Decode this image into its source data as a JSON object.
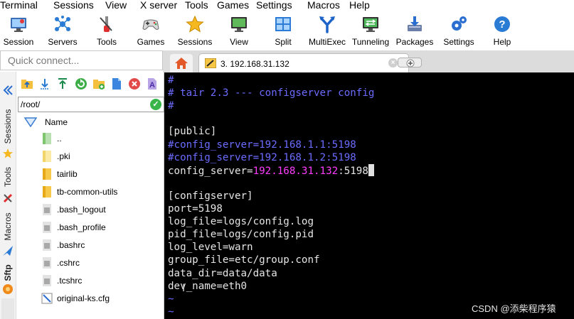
{
  "menu": [
    "Terminal",
    "Sessions",
    "View",
    "X server",
    "Tools",
    "Games",
    "Settings",
    "Macros",
    "Help"
  ],
  "toolbar": [
    {
      "label": "Session",
      "icon": "session-monitor-icon"
    },
    {
      "label": "Servers",
      "icon": "servers-network-icon"
    },
    {
      "label": "Tools",
      "icon": "tools-icon"
    },
    {
      "label": "Games",
      "icon": "gamepad-icon"
    },
    {
      "label": "Sessions",
      "icon": "star-icon"
    },
    {
      "label": "View",
      "icon": "view-monitor-icon"
    },
    {
      "label": "Split",
      "icon": "split-icon"
    },
    {
      "label": "MultiExec",
      "icon": "multiexec-icon"
    },
    {
      "label": "Tunneling",
      "icon": "tunneling-icon"
    },
    {
      "label": "Packages",
      "icon": "packages-icon"
    },
    {
      "label": "Settings",
      "icon": "gears-icon"
    },
    {
      "label": "Help",
      "icon": "help-icon"
    }
  ],
  "quick_connect": {
    "placeholder": "Quick connect..."
  },
  "tabs": {
    "session_label": "3. 192.168.31.132",
    "new_tab": "+"
  },
  "sidebar": {
    "vertical_tabs": [
      "Sessions",
      "Tools",
      "Macros",
      "Sftp"
    ]
  },
  "sftp": {
    "path": "/root/",
    "column_name": "Name",
    "files": [
      {
        "name": "..",
        "type": "parent"
      },
      {
        "name": ".pki",
        "type": "folder"
      },
      {
        "name": "tairlib",
        "type": "folder"
      },
      {
        "name": "tb-common-utils",
        "type": "folder"
      },
      {
        "name": ".bash_logout",
        "type": "file"
      },
      {
        "name": ".bash_profile",
        "type": "file"
      },
      {
        "name": ".bashrc",
        "type": "file"
      },
      {
        "name": ".cshrc",
        "type": "file"
      },
      {
        "name": ".tcshrc",
        "type": "file"
      },
      {
        "name": "original-ks.cfg",
        "type": "cfg"
      }
    ]
  },
  "terminal": {
    "lines": [
      [
        {
          "t": "#",
          "c": "#6b6bff"
        }
      ],
      [
        {
          "t": "# tair 2.3 --- configserver config",
          "c": "#6b6bff"
        }
      ],
      [
        {
          "t": "#",
          "c": "#6b6bff"
        }
      ],
      [
        {
          "t": "",
          "c": "#e6e6e6"
        }
      ],
      [
        {
          "t": "[public]",
          "c": "#e6e6e6"
        }
      ],
      [
        {
          "t": "#config_server=192.168.1.1:5198",
          "c": "#6b6bff"
        }
      ],
      [
        {
          "t": "#config_server=192.168.1.2:5198",
          "c": "#6b6bff"
        }
      ],
      [
        {
          "t": "config_server=",
          "c": "#e6e6e6"
        },
        {
          "t": "192.168.31.132",
          "c": "#ff3cff"
        },
        {
          "t": ":5198",
          "c": "#e6e6e6"
        }
      ],
      [
        {
          "t": "",
          "c": "#e6e6e6"
        }
      ],
      [
        {
          "t": "[configserver]",
          "c": "#e6e6e6"
        }
      ],
      [
        {
          "t": "port=5198",
          "c": "#e6e6e6"
        }
      ],
      [
        {
          "t": "log_file=logs/config.log",
          "c": "#e6e6e6"
        }
      ],
      [
        {
          "t": "pid_file=logs/config.pid",
          "c": "#e6e6e6"
        }
      ],
      [
        {
          "t": "log_level=warn",
          "c": "#e6e6e6"
        }
      ],
      [
        {
          "t": "group_file=etc/group.conf",
          "c": "#e6e6e6"
        }
      ],
      [
        {
          "t": "data_dir=data/data",
          "c": "#e6e6e6"
        }
      ],
      [
        {
          "t": "dev_name=eth0",
          "c": "#e6e6e6"
        }
      ],
      [
        {
          "t": "~",
          "c": "#6b6bff"
        }
      ],
      [
        {
          "t": "~",
          "c": "#6b6bff"
        }
      ]
    ]
  },
  "watermark": "CSDN @添柴程序猿"
}
